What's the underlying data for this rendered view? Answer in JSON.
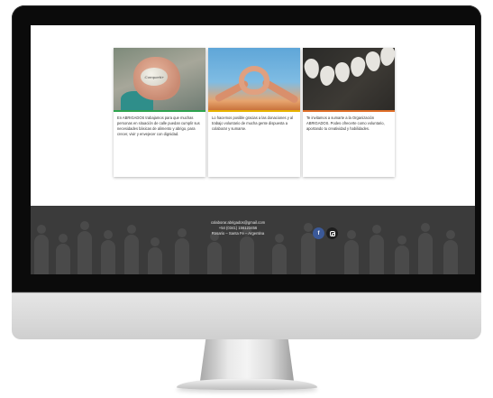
{
  "cards": [
    {
      "image_caption": "Compartir",
      "text": "En ABRIGADOS trabajamos para que muchas personas en situación de calle puedan cumplir sus necesidades básicas de alimento y abrigo, para crecer, vivir y envejecer con dignidad.",
      "accent": "#2ea44f"
    },
    {
      "text": "Lo hacemos posible gracias a las donaciones y al trabajo voluntario de mucha gente dispuesta a colaborar y sumarse.",
      "accent": "#e8b400"
    },
    {
      "text": "Te invitamos a sumarte a la Organización ABRIGADOS. Podes ofrecerte como voluntario, aportando tu creatividad y habilidades.",
      "accent": "#e0702a"
    }
  ],
  "footer": {
    "email": "colaborar.abrigados@gmail.com",
    "phone": "+54 (0341) 156123456",
    "location": "Rosario – Santa Fe – Argentina",
    "social": [
      {
        "icon": "facebook-icon",
        "glyph": "f",
        "color": "#3b5998"
      },
      {
        "icon": "instagram-icon",
        "color": "#1e1e1e"
      }
    ]
  }
}
